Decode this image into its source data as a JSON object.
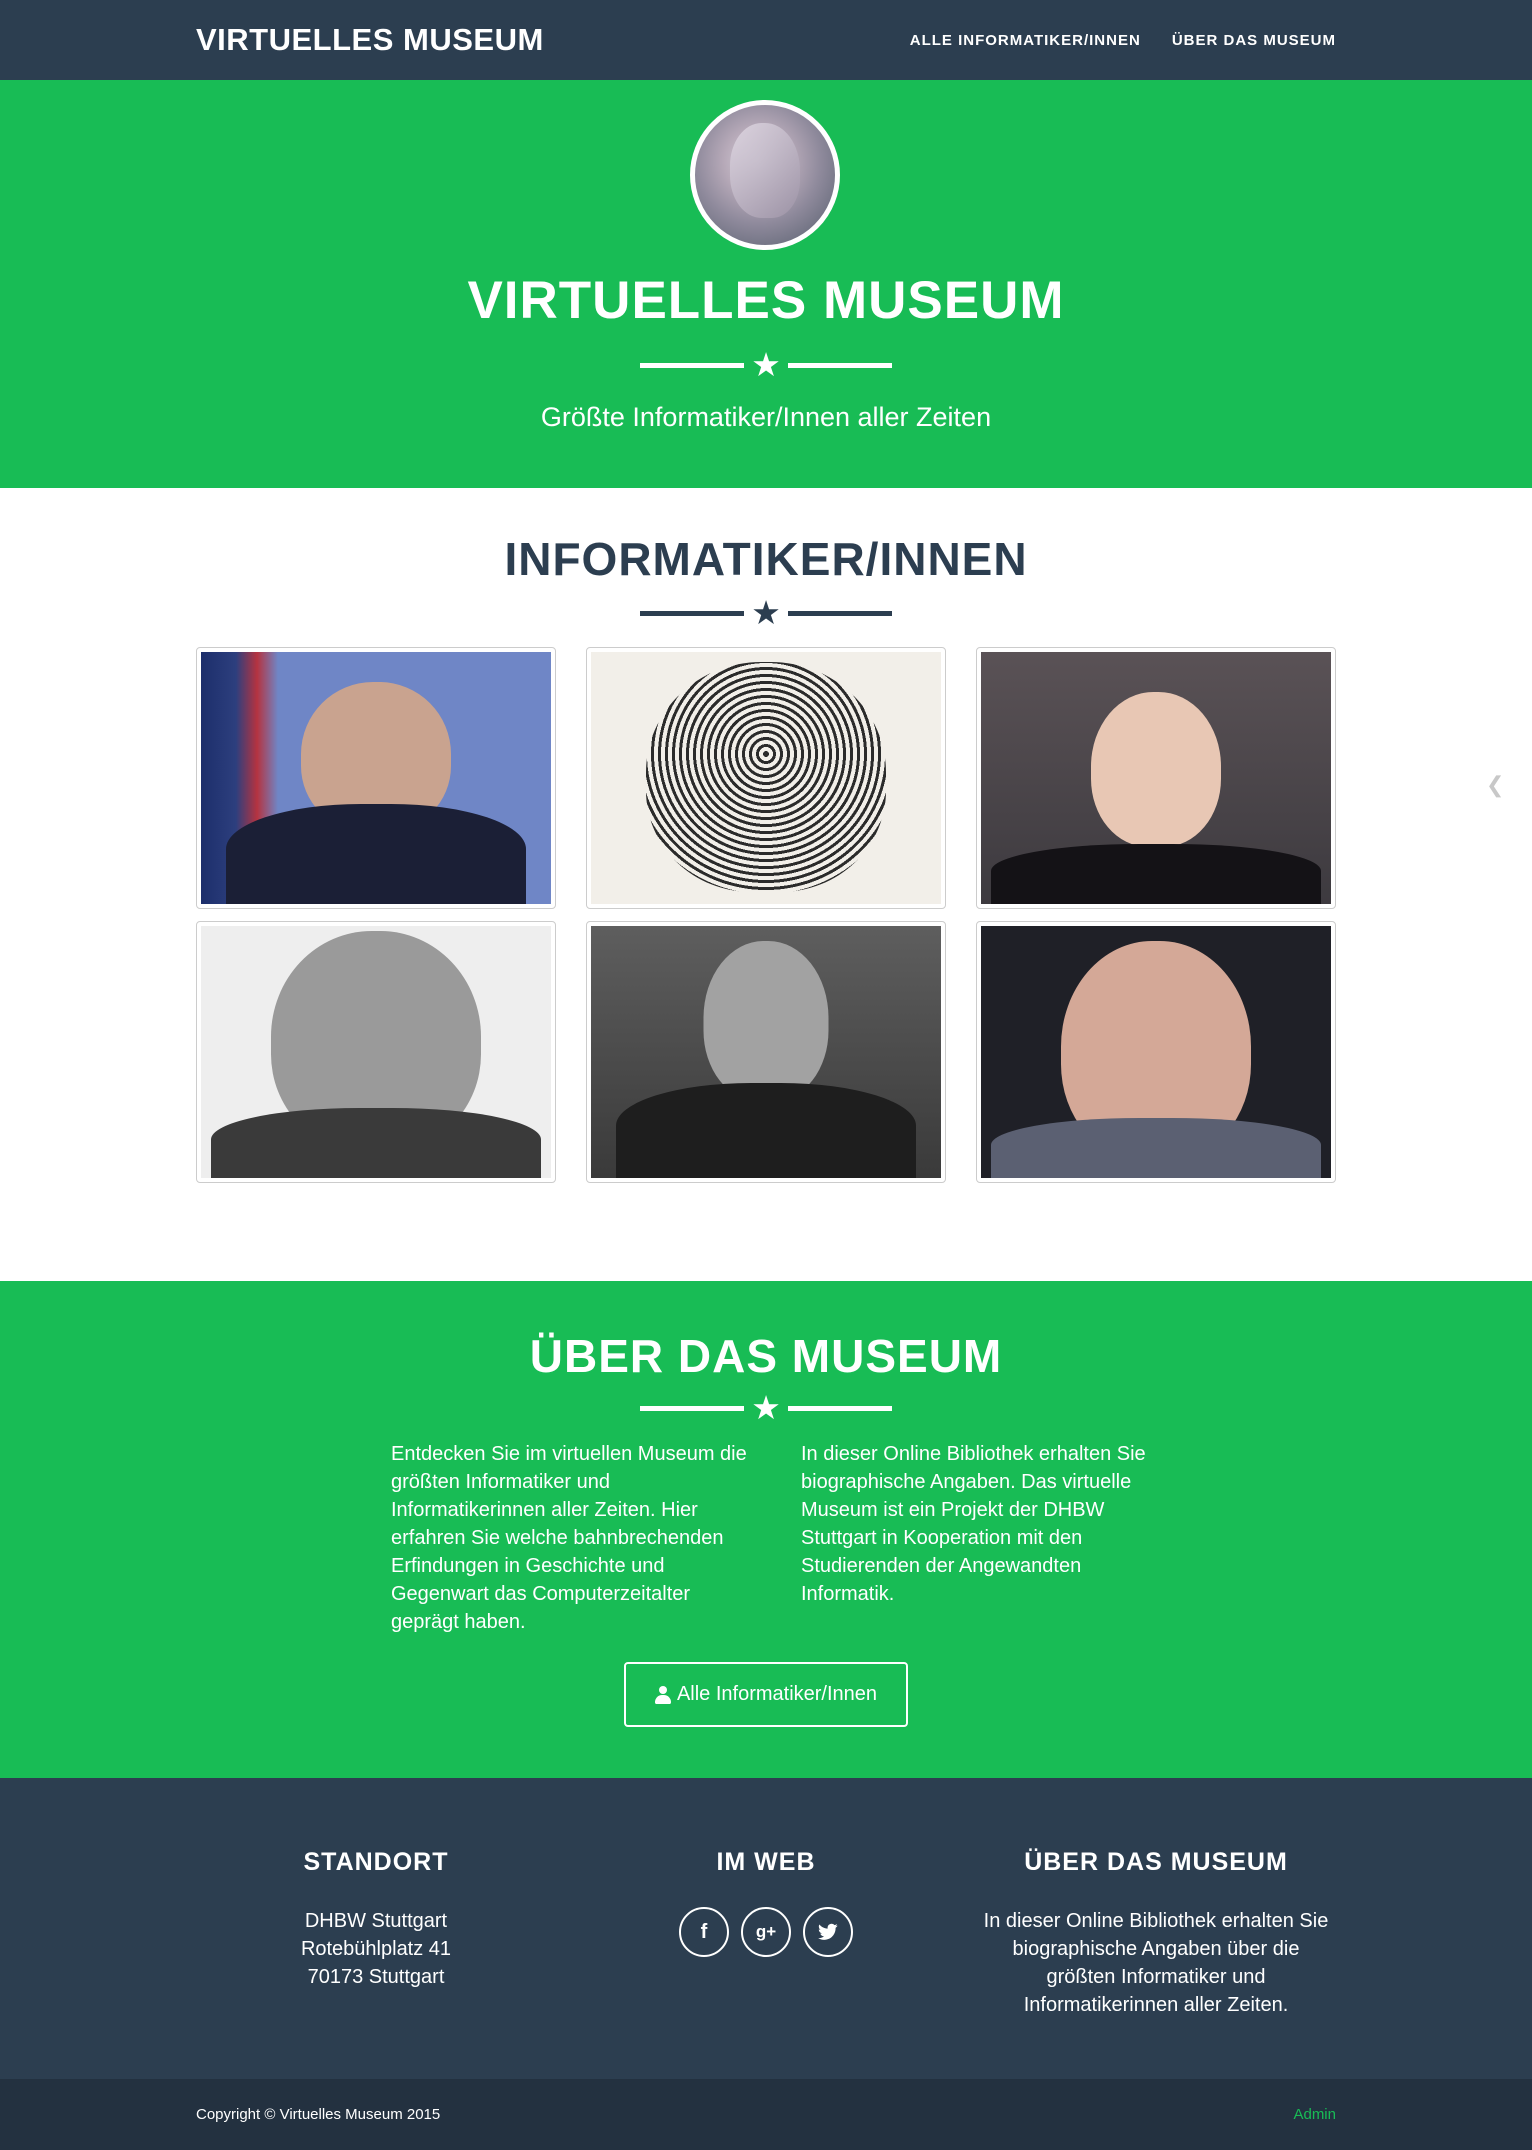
{
  "navbar": {
    "brand": "VIRTUELLES MUSEUM",
    "links": [
      "ALLE INFORMATIKER/INNEN",
      "ÜBER DAS MUSEUM"
    ]
  },
  "hero": {
    "title": "VIRTUELLES MUSEUM",
    "subtitle": "Größte Informatiker/Innen aller Zeiten"
  },
  "portfolio": {
    "title": "INFORMATIKER/INNEN"
  },
  "about": {
    "title": "ÜBER DAS MUSEUM",
    "text_left": "Entdecken Sie im virtuellen Museum die größten Informatiker und Informatikerinnen aller Zeiten. Hier erfahren Sie welche bahnbrechenden Erfindungen in Geschichte und Gegenwart das Computerzeitalter geprägt haben.",
    "text_right": "In dieser Online Bibliothek erhalten Sie biographische Angaben. Das virtuelle Museum ist ein Projekt der DHBW Stuttgart in Kooperation mit den Studierenden der Angewandten Informatik.",
    "button_label": "Alle Informatiker/Innen"
  },
  "footer": {
    "location": {
      "title": "STANDORT",
      "line1": "DHBW Stuttgart",
      "line2": "Rotebühlplatz 41",
      "line3": "70173 Stuttgart"
    },
    "web": {
      "title": "IM WEB",
      "icons": [
        "facebook-icon",
        "google-plus-icon",
        "twitter-icon"
      ]
    },
    "about": {
      "title": "ÜBER DAS MUSEUM",
      "text": "In dieser Online Bibliothek erhalten Sie biographische Angaben über die größten Informatiker und Informatikerinnen aller Zeiten."
    },
    "copyright": "Copyright © Virtuelles Museum 2015",
    "admin": "Admin"
  },
  "colors": {
    "primary": "#2c3e50",
    "success": "#18bc55",
    "footer_bottom": "#233140"
  }
}
